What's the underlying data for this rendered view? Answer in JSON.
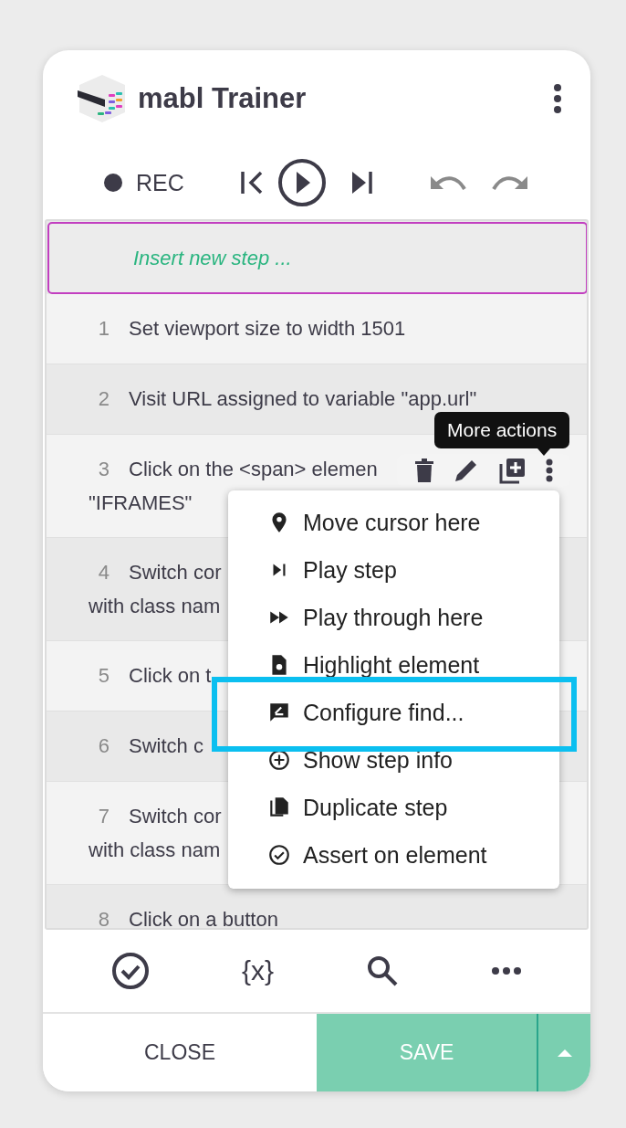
{
  "app": {
    "title": "mabl Trainer"
  },
  "controls": {
    "record_label": "REC"
  },
  "insert_step": {
    "placeholder": "Insert new step ..."
  },
  "steps": [
    {
      "number": "1",
      "lines": [
        "Set viewport size to width 1501"
      ]
    },
    {
      "number": "2",
      "lines": [
        "Visit URL assigned to variable \"app.url\""
      ]
    },
    {
      "number": "3",
      "lines": [
        "Click on the <span> elemen",
        "\"IFRAMES\""
      ]
    },
    {
      "number": "4",
      "lines": [
        "Switch cor",
        "with class nam"
      ]
    },
    {
      "number": "5",
      "lines": [
        "Click on t"
      ]
    },
    {
      "number": "6",
      "lines": [
        "Switch c"
      ]
    },
    {
      "number": "7",
      "lines": [
        "Switch cor",
        "with class nam"
      ]
    },
    {
      "number": "8",
      "lines": [
        "Click on a button"
      ]
    }
  ],
  "row_actions": {
    "tooltip": "More actions"
  },
  "context_menu": {
    "items": [
      {
        "label": "Move cursor here",
        "kind": "pin",
        "outlined": false
      },
      {
        "label": "Play step",
        "kind": "step",
        "outlined": false
      },
      {
        "label": "Play through here",
        "kind": "forward",
        "outlined": false
      },
      {
        "label": "Highlight element",
        "kind": "highlight",
        "outlined": false
      },
      {
        "label": "Configure find...",
        "kind": "configure",
        "outlined": true
      },
      {
        "label": "Show step info",
        "kind": "info",
        "outlined": false
      },
      {
        "label": "Duplicate step",
        "kind": "duplicate",
        "outlined": false
      },
      {
        "label": "Assert on element",
        "kind": "assert",
        "outlined": false
      }
    ]
  },
  "toolbar": {
    "variables_label": "{x}"
  },
  "footer": {
    "close": "CLOSE",
    "save": "SAVE"
  }
}
